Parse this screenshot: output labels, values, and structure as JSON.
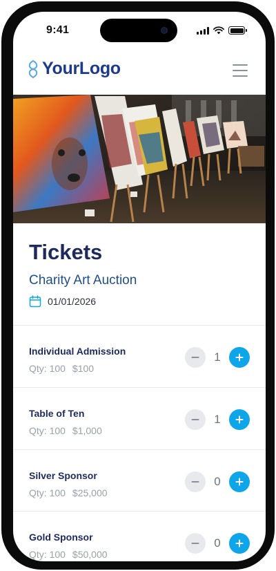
{
  "status_bar": {
    "time": "9:41"
  },
  "header": {
    "logo_text": "YourLogo"
  },
  "hero": {
    "description": "Art gallery with paintings on easels"
  },
  "page": {
    "title": "Tickets",
    "event_name": "Charity Art Auction",
    "event_date": "01/01/2026"
  },
  "tickets": [
    {
      "name": "Individual Admission",
      "qty_label": "Qty: 100",
      "price": "$100",
      "count": "1"
    },
    {
      "name": "Table of Ten",
      "qty_label": "Qty: 100",
      "price": "$1,000",
      "count": "1"
    },
    {
      "name": "Silver Sponsor",
      "qty_label": "Qty: 100",
      "price": "$25,000",
      "count": "0"
    },
    {
      "name": "Gold Sponsor",
      "qty_label": "Qty: 100",
      "price": "$50,000",
      "count": "0"
    }
  ],
  "colors": {
    "brand": "#1e3a8a",
    "title": "#1e2a5e",
    "accent": "#0ea5e9",
    "muted": "#9aa0a8"
  }
}
